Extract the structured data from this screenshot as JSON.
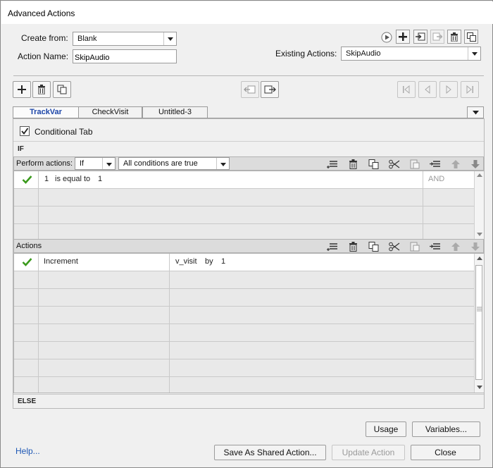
{
  "window": {
    "title": "Advanced Actions"
  },
  "header": {
    "create_from_label": "Create from:",
    "create_from_value": "Blank",
    "action_name_label": "Action Name:",
    "action_name_value": "SkipAudio",
    "existing_actions_label": "Existing Actions:",
    "existing_actions_value": "SkipAudio"
  },
  "tabs": [
    {
      "label": "TrackVar",
      "active": true
    },
    {
      "label": "CheckVisit",
      "active": false
    },
    {
      "label": "Untitled-3",
      "active": false
    }
  ],
  "conditional": {
    "label": "Conditional Tab",
    "checked": true
  },
  "if_section": {
    "header": "IF",
    "perform_label": "Perform actions:",
    "perform_value": "If",
    "condition_mode": "All conditions are true",
    "rows": [
      {
        "operand1": "1",
        "operator": "is equal to",
        "operand2": "1",
        "logic": "AND"
      }
    ]
  },
  "actions_section": {
    "header": "Actions",
    "rows": [
      {
        "action": "Increment",
        "target": "v_visit",
        "by_label": "by",
        "amount": "1"
      }
    ]
  },
  "else_section": {
    "header": "ELSE"
  },
  "buttons": {
    "usage": "Usage",
    "variables": "Variables...",
    "help": "Help...",
    "save_shared": "Save As Shared Action...",
    "update": "Update Action",
    "close": "Close"
  },
  "colors": {
    "accent": "#1b45a8",
    "check": "#3a9a1c",
    "link": "#1d57b5"
  }
}
